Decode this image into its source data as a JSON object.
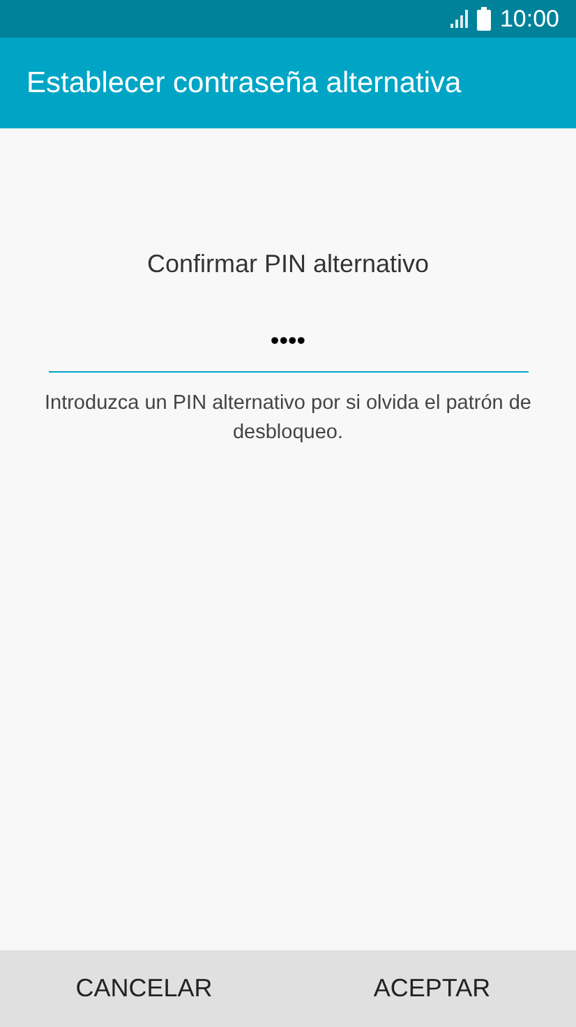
{
  "status_bar": {
    "time": "10:00"
  },
  "app_bar": {
    "title": "Establecer contraseña alternativa"
  },
  "prompt": "Confirmar PIN alternativo",
  "pin_field": {
    "value": "••••"
  },
  "hint": "Introduzca un PIN alternativo por si olvida el patrón de desbloqueo.",
  "buttons": [
    "CANCELAR",
    "ACEPTAR"
  ]
}
